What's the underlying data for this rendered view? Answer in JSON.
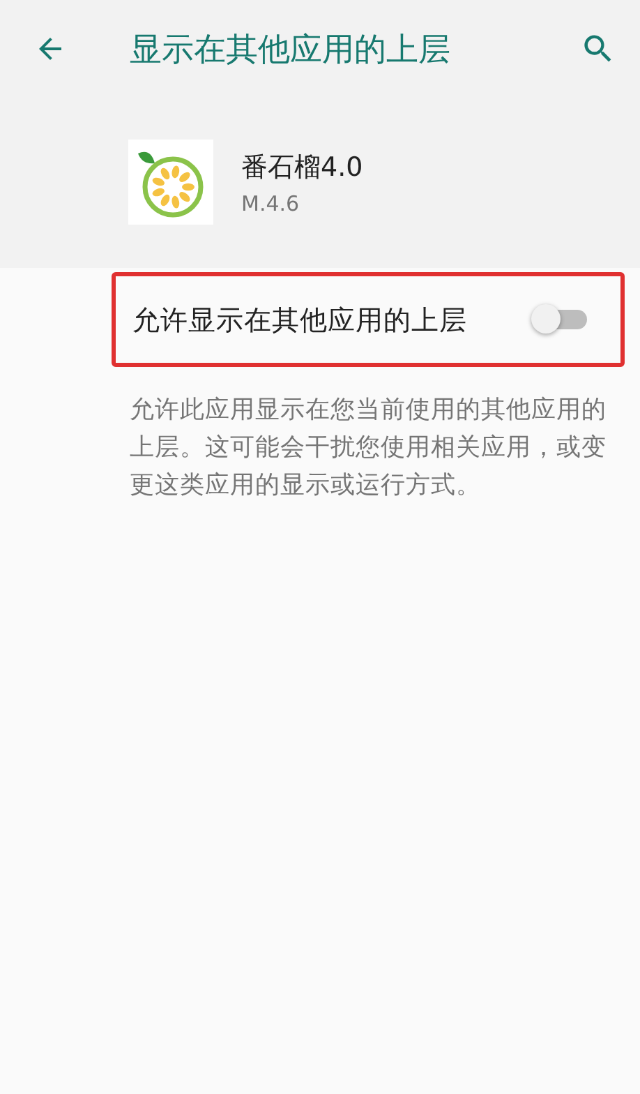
{
  "toolbar": {
    "title": "显示在其他应用的上层"
  },
  "app": {
    "name": "番石榴4.0",
    "version": "M.4.6"
  },
  "setting": {
    "label": "允许显示在其他应用的上层",
    "on": false,
    "highlighted": true
  },
  "description": "允许此应用显示在您当前使用的其他应用的上层。这可能会干扰您使用相关应用，或变更这类应用的显示或运行方式。"
}
